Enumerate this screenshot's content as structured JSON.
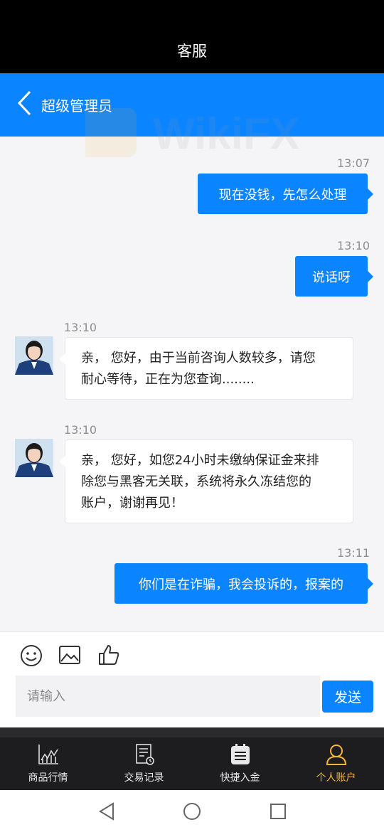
{
  "status_bar": {
    "title": "客服"
  },
  "header": {
    "title": "超级管理员"
  },
  "messages": [
    {
      "direction": "out",
      "time": "13:07",
      "text": "现在没钱，先怎么处理"
    },
    {
      "direction": "out",
      "time": "13:10",
      "text": "说话呀"
    },
    {
      "direction": "in",
      "time": "13:10",
      "lines": [
        "亲， 您好，由于当前咨询人数较多，请您",
        "耐心等待，正在为您查询........"
      ]
    },
    {
      "direction": "in",
      "time": "13:10",
      "lines": [
        "亲， 您好，如您24小时未缴纳保证金来排",
        "除您与黑客无关联，系统将永久冻结您的",
        "账户，谢谢再见！"
      ]
    },
    {
      "direction": "out",
      "time": "13:11",
      "text": "你们是在诈骗，我会投诉的，报案的"
    }
  ],
  "composer": {
    "tools": [
      "emoji-icon",
      "image-icon",
      "thumbs-up-icon"
    ],
    "input_value": "",
    "placeholder": "请输入",
    "send_label": "发送"
  },
  "bottom_nav": [
    {
      "label": "商品行情",
      "icon": "market-chart-icon",
      "active": false
    },
    {
      "label": "交易记录",
      "icon": "trade-record-icon",
      "active": false
    },
    {
      "label": "快捷入金",
      "icon": "quick-deposit-icon",
      "active": false
    },
    {
      "label": "个人账户",
      "icon": "account-icon",
      "active": true
    }
  ],
  "colors": {
    "accent": "#0a84ff",
    "active_tab": "#f2b63a",
    "nav_bg": "#1d1d1f"
  },
  "watermark": "WikiFX",
  "system_nav": [
    "back-icon",
    "home-icon",
    "recents-icon"
  ]
}
